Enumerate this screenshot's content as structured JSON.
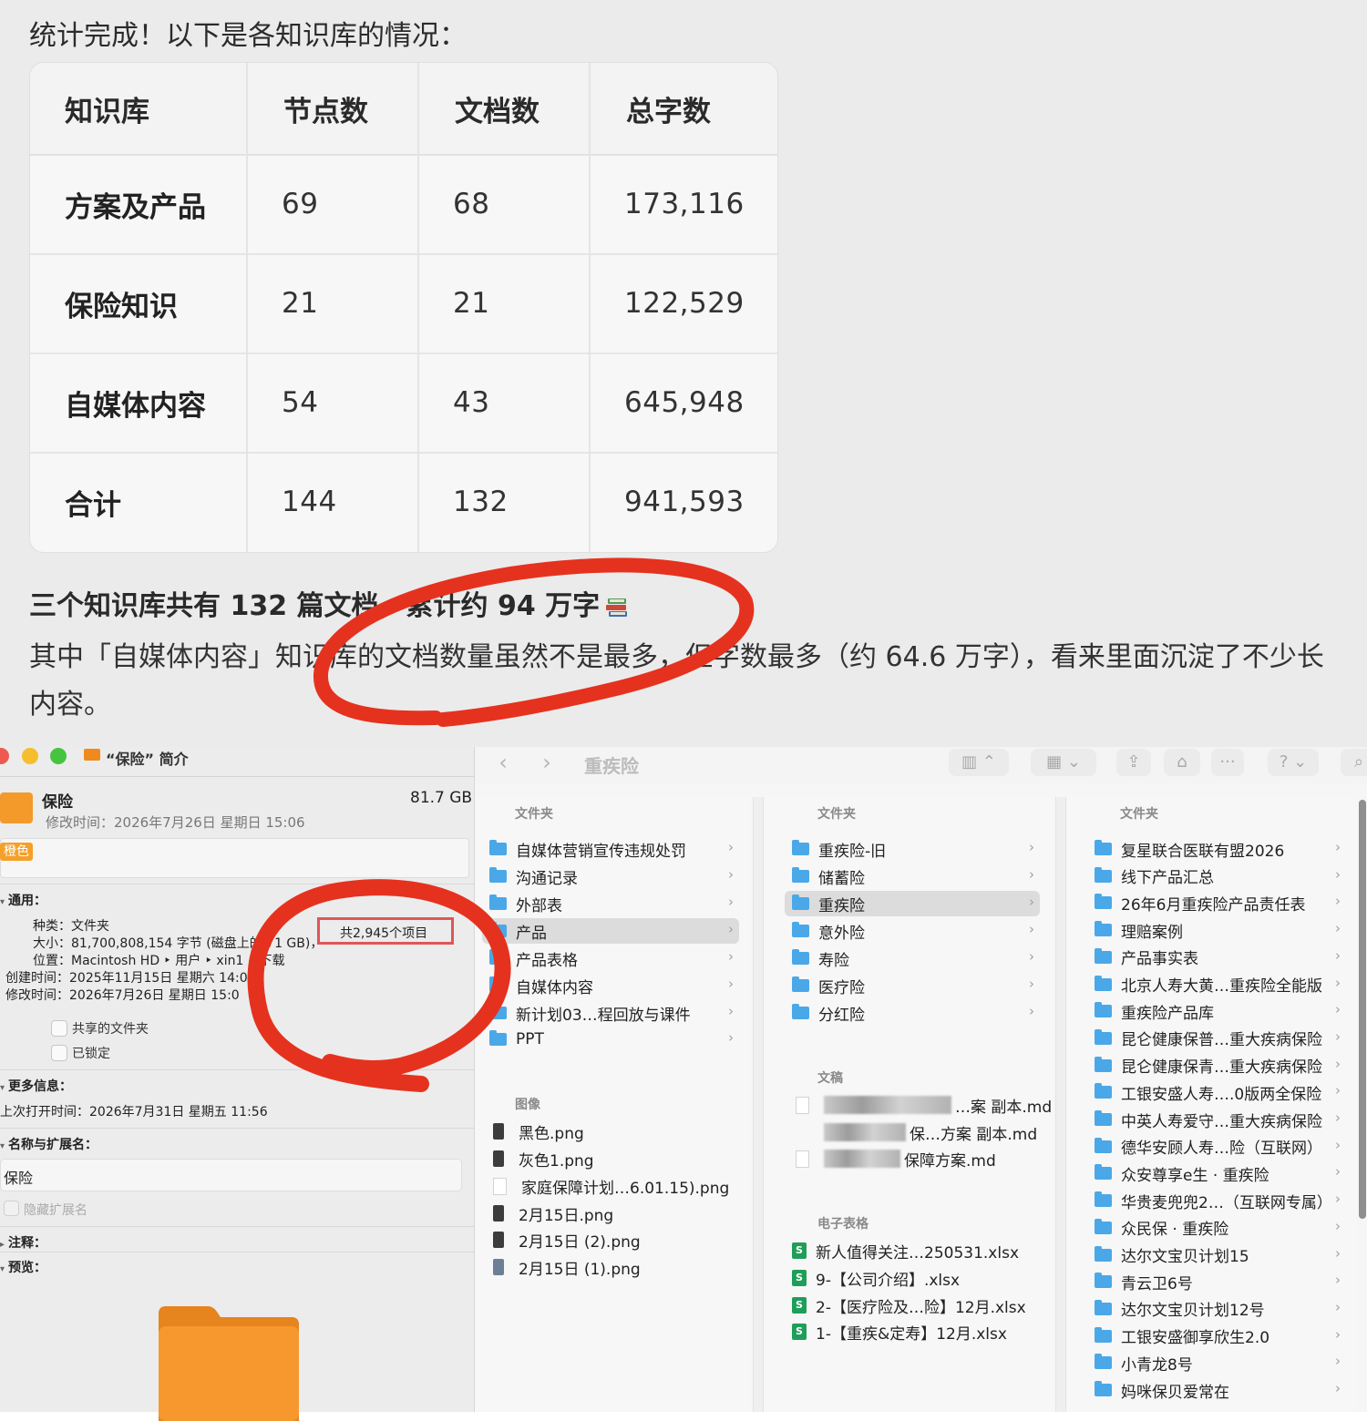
{
  "chat": {
    "intro": "统计完成！以下是各知识库的情况：",
    "table": {
      "headers": [
        "知识库",
        "节点数",
        "文档数",
        "总字数"
      ],
      "rows": [
        [
          "方案及产品",
          "69",
          "68",
          "173,116"
        ],
        [
          "保险知识",
          "21",
          "21",
          "122,529"
        ],
        [
          "自媒体内容",
          "54",
          "43",
          "645,948"
        ],
        [
          "合计",
          "144",
          "132",
          "941,593"
        ]
      ]
    },
    "summary": "三个知识库共有 132 篇文档，累计约 94 万字",
    "summary_icon": "books-emoji-icon",
    "detail": "其中「自媒体内容」知识库的文档数量虽然不是最多，但字数最多（约 64.6 万字），看来里面沉淀了不少长内容。"
  },
  "info_window": {
    "title": "“保险” 简介",
    "name": "保险",
    "size": "81.7 GB",
    "modified": "修改时间：2026年7月26日 星期日 15:06",
    "tag": "橙色",
    "general": {
      "heading": "通用：",
      "kind_label": "种类：",
      "kind": "文件夹",
      "size_label": "大小：",
      "size_detail": "81,700,808,154 字节 (磁盘上的 ",
      "size_detail_tail": "71 GB)，",
      "item_count": "共2,945个项目",
      "location_label": "位置：",
      "location": "Macintosh HD ‣ 用户 ‣ xin1 ‣ 下载",
      "created_label": "创建时间：",
      "created": "2025年11月15日 星期六 14:0",
      "modified_label": "修改时间：",
      "modified": "2026年7月26日 星期日 15:0",
      "shared_folder": "共享的文件夹",
      "locked": "已锁定"
    },
    "more_info": {
      "heading": "更多信息：",
      "last_opened": "上次打开时间：2026年7月31日 星期五 11:56"
    },
    "name_ext": {
      "heading": "名称与扩展名：",
      "value": "保险",
      "hide_ext": "隐藏扩展名"
    },
    "comments_heading": "注释：",
    "preview_heading": "预览："
  },
  "finder": {
    "title": "重疾险",
    "colors": {
      "folder": "#4aa8e8",
      "selection": "#dcdcdc"
    },
    "col1": {
      "folders_heading": "文件夹",
      "folders": [
        "自媒体营销宣传违规处罚",
        "沟通记录",
        "外部表",
        "产品",
        "产品表格",
        "自媒体内容",
        "新计划03…程回放与课件",
        "PPT"
      ],
      "images_heading": "图像",
      "images": [
        "黑色.png",
        "灰色1.png",
        "家庭保障计划…6.01.15).png",
        "2月15日.png",
        "2月15日 (2).png",
        "2月15日 (1).png"
      ]
    },
    "col2": {
      "folders_heading": "文件夹",
      "folders": [
        "重疾险-旧",
        "储蓄险",
        "重疾险",
        "意外险",
        "寿险",
        "医疗险",
        "分红险"
      ],
      "docs_heading": "文稿",
      "docs": [
        "…案 副本.md",
        "保…方案 副本.md",
        "保障方案.md"
      ],
      "sheets_heading": "电子表格",
      "sheets": [
        "新人值得关注…250531.xlsx",
        "9-【公司介绍】.xlsx",
        "2-【医疗险及…险】12月.xlsx",
        "1-【重疾&定寿】12月.xlsx"
      ]
    },
    "col3": {
      "folders_heading": "文件夹",
      "folders": [
        "复星联合医联有盟2026",
        "线下产品汇总",
        "26年6月重疾险产品责任表",
        "理赔案例",
        "产品事实表",
        "北京人寿大黄…重疾险全能版",
        "重疾险产品库",
        "昆仑健康保普…重大疾病保险",
        "昆仑健康保青…重大疾病保险",
        "工银安盛人寿….0版两全保险",
        "中英人寿爱守…重大疾病保险",
        "德华安顾人寿…险（互联网）",
        "众安尊享e生 · 重疾险",
        "华贵麦兜兜2…（互联网专属）",
        "众民保 · 重疾险",
        "达尔文宝贝计划15",
        "青云卫6号",
        "达尔文宝贝计划12号",
        "工银安盛御享欣生2.0",
        "小青龙8号",
        "妈咪保贝爱常在"
      ]
    }
  }
}
